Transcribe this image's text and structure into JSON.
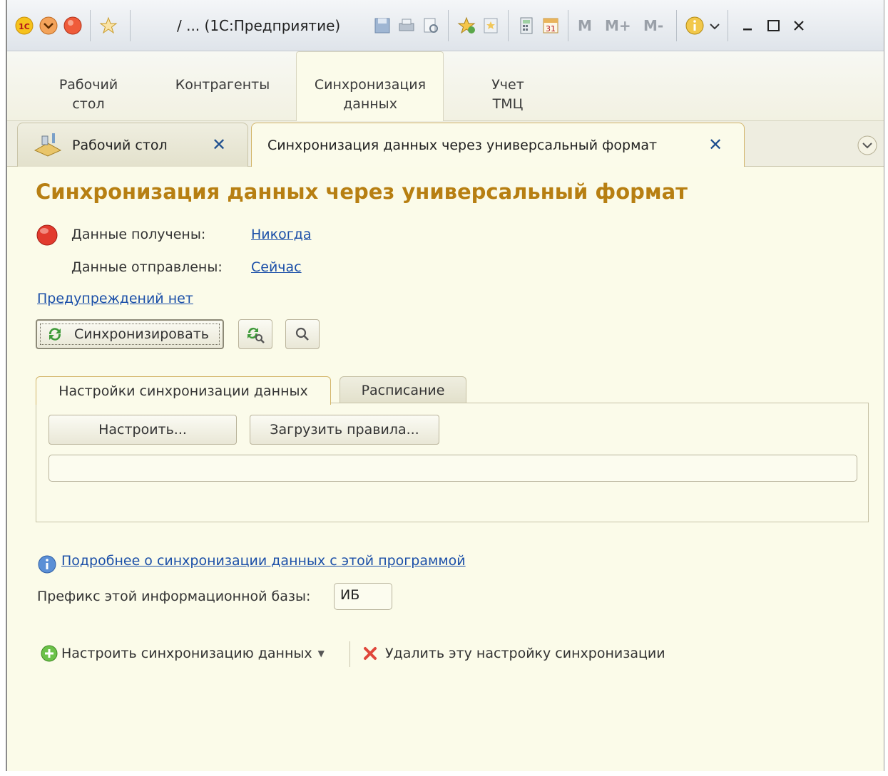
{
  "titlebar": {
    "title": "/ ... (1С:Предприятие)",
    "mem_labels": [
      "M",
      "M+",
      "M-"
    ],
    "icons": [
      "app-logo-icon",
      "dropdown-menu-icon",
      "home-icon",
      "favorite-star-icon",
      "save-icon",
      "print-icon",
      "preview-icon",
      "add-favorite-icon",
      "favorites-list-icon",
      "calculator-icon",
      "calendar-icon",
      "info-icon",
      "minimize-icon",
      "maximize-icon",
      "close-icon"
    ],
    "calendar_day": "31"
  },
  "sections": [
    {
      "line1": "Рабочий",
      "line2": "стол"
    },
    {
      "line1": "Контрагенты",
      "line2": ""
    },
    {
      "line1": "Синхронизация",
      "line2": "данных"
    },
    {
      "line1": "Учет",
      "line2": "ТМЦ"
    }
  ],
  "tabs": {
    "desktop": "Рабочий стол",
    "sync": "Синхронизация данных через универсальный формат"
  },
  "form": {
    "title": "Синхронизация данных через универсальный формат",
    "received_label": "Данные получены:",
    "received_value": "Никогда",
    "sent_label": "Данные отправлены:",
    "sent_value": "Сейчас",
    "warnings_link": "Предупреждений нет",
    "sync_button": "Синхронизировать",
    "inner_tabs": [
      "Настройки синхронизации данных",
      "Расписание"
    ],
    "configure_button": "Настроить...",
    "load_rules_button": "Загрузить правила...",
    "rules_field_value": "",
    "more_info_link": "Подробнее о синхронизации данных с этой программой",
    "prefix_label": "Префикс этой информационной базы:",
    "prefix_value": "ИБ",
    "setup_sync_command": "Настроить синхронизацию данных",
    "delete_setting_command": "Удалить эту настройку синхронизации"
  },
  "colors": {
    "accent_title": "#b77f12",
    "link": "#1b4fa8",
    "background": "#fbfbe9",
    "status_red": "#e23b2e"
  }
}
